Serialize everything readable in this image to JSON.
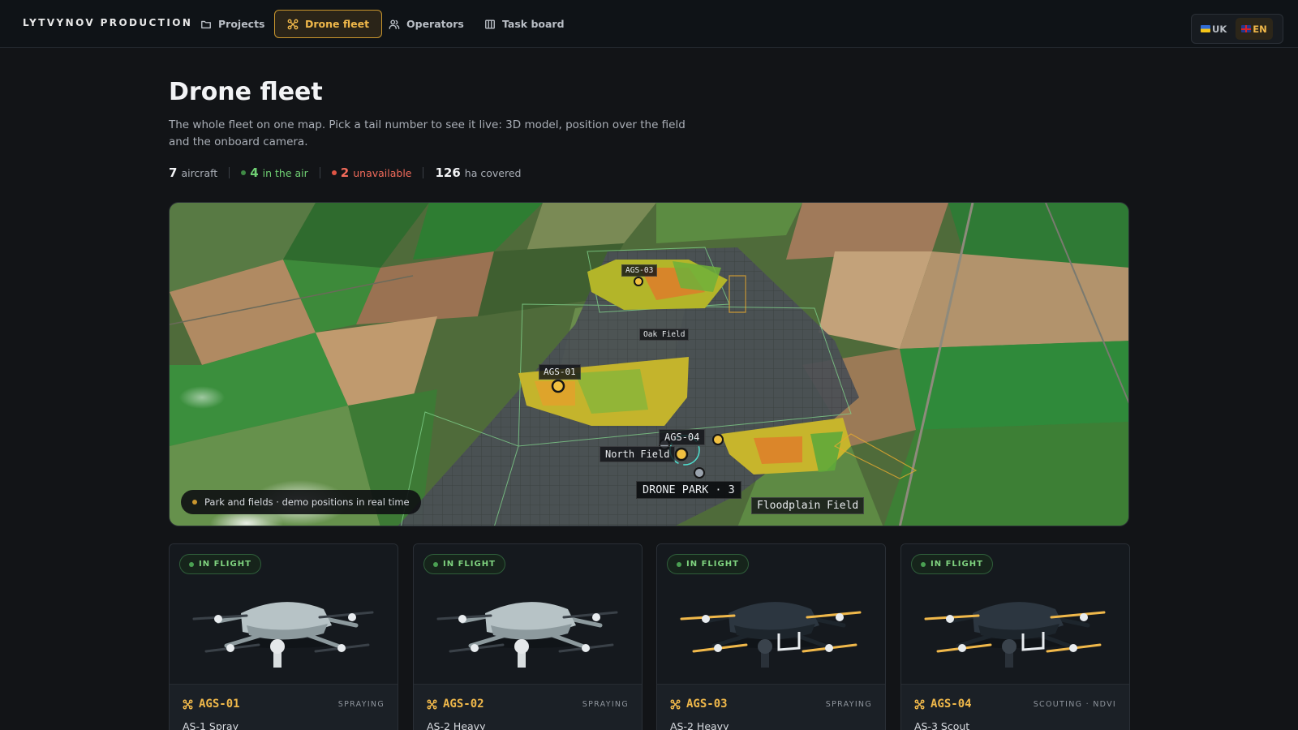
{
  "brand": "LYTVYNOV PRODUCTION",
  "nav": {
    "tabs": [
      {
        "label": "Projects",
        "icon": "folder-icon",
        "active": false
      },
      {
        "label": "Drone fleet",
        "icon": "drone-icon",
        "active": true
      },
      {
        "label": "Operators",
        "icon": "users-icon",
        "active": false
      },
      {
        "label": "Task board",
        "icon": "board-icon",
        "active": false
      }
    ],
    "languages": [
      {
        "code": "UK",
        "selected": false
      },
      {
        "code": "EN",
        "selected": true
      }
    ]
  },
  "page": {
    "title": "Drone fleet",
    "subtitle": "The whole fleet on one map. Pick a tail number to see it live: 3D model, position over the field and the onboard camera."
  },
  "stats": {
    "aircraft_value": "7",
    "aircraft_label": "aircraft",
    "in_air_value": "4",
    "in_air_label": "in the air",
    "unavailable_value": "2",
    "unavailable_label": "unavailable",
    "covered_value": "126",
    "covered_label": "ha covered"
  },
  "map": {
    "drone_labels": [
      "AGS-03",
      "AGS-01",
      "AGS-04"
    ],
    "field_labels": [
      "Oak Field",
      "North Field",
      "Floodplain Field"
    ],
    "park_label": "DRONE PARK · 3",
    "caption": "Park and fields · demo positions in real time"
  },
  "colors": {
    "accent": "#f0b84a",
    "in_flight": "#6fcf73",
    "unavailable": "#f26b5b"
  },
  "drones": [
    {
      "status": "IN FLIGHT",
      "tail": "AGS-01",
      "mission": "SPRAYING",
      "model": "AS-1 Spray",
      "style": "grey"
    },
    {
      "status": "IN FLIGHT",
      "tail": "AGS-02",
      "mission": "SPRAYING",
      "model": "AS-2 Heavy",
      "style": "grey"
    },
    {
      "status": "IN FLIGHT",
      "tail": "AGS-03",
      "mission": "SPRAYING",
      "model": "AS-2 Heavy",
      "style": "dark"
    },
    {
      "status": "IN FLIGHT",
      "tail": "AGS-04",
      "mission": "SCOUTING · NDVI",
      "model": "AS-3 Scout",
      "style": "dark"
    }
  ]
}
